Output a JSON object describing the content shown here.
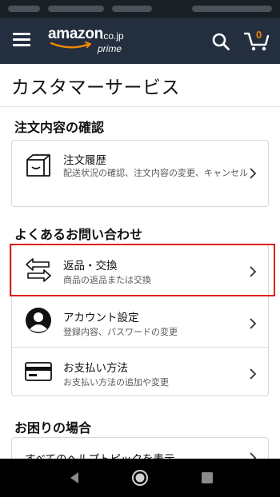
{
  "header": {
    "logo_main": "amazon",
    "logo_tld": ".co.jp",
    "logo_sub": "prime",
    "cart_count": "0",
    "icons": [
      "menu-icon",
      "search-icon",
      "cart-icon"
    ]
  },
  "page": {
    "title": "カスタマーサービス"
  },
  "sections": {
    "orders": {
      "title": "注文内容の確認",
      "items": [
        {
          "icon": "box-icon",
          "title": "注文履歴",
          "subtitle": "配送状況の確認、注文内容の変更、キャンセル"
        }
      ]
    },
    "faq": {
      "title": "よくあるお問い合わせ",
      "items": [
        {
          "icon": "exchange-arrows-icon",
          "title": "返品・交換",
          "subtitle": "商品の返品または交換"
        },
        {
          "icon": "account-icon",
          "title": "アカウント設定",
          "subtitle": "登録内容、パスワードの変更"
        },
        {
          "icon": "credit-card-icon",
          "title": "お支払い方法",
          "subtitle": "お支払い方法の追加や変更"
        }
      ]
    },
    "help": {
      "title": "お困りの場合",
      "items": [
        {
          "title": "すべてのヘルプトピックを表示"
        }
      ]
    }
  },
  "colors": {
    "header_bg": "#232f3e",
    "highlight": "#e0201a",
    "cart_accent": "#f08804"
  }
}
